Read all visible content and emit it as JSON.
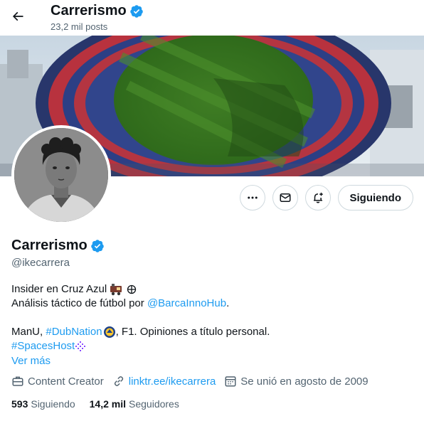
{
  "header": {
    "name": "Carrerismo",
    "posts": "23,2 mil posts"
  },
  "profile": {
    "name": "Carrerismo",
    "handle": "@ikecarrera",
    "verified": true
  },
  "actions": {
    "follow_label": "Siguiendo"
  },
  "bio": {
    "line1": "Insider en Cruz Azul",
    "line2_prefix": "Análisis táctico de fútbol por ",
    "line2_link": "@BarcaInnoHub",
    "line2_suffix": ".",
    "line3_prefix": "ManU, ",
    "line3_link": "#DubNation",
    "line3_suffix": ", F1. Opiniones a título personal.",
    "line4_link": "#SpacesHost"
  },
  "ver_mas": "Ver más",
  "meta": {
    "category": "Content Creator",
    "website": "linktr.ee/ikecarrera",
    "joined": "Se unió en agosto de 2009"
  },
  "stats": {
    "following_count": "593",
    "following_label": "Siguiendo",
    "followers_count": "14,2 mil",
    "followers_label": "Seguidores"
  },
  "colors": {
    "accent": "#1d9bf0",
    "text": "#0f1419",
    "secondary": "#536471",
    "border": "#cfd9de"
  },
  "icons": {
    "back": "arrow-left-icon",
    "verified": "verified-badge-icon",
    "more": "more-icon",
    "message": "envelope-icon",
    "notify": "bell-plus-icon",
    "category": "briefcase-icon",
    "website": "link-icon",
    "joined": "calendar-icon"
  }
}
